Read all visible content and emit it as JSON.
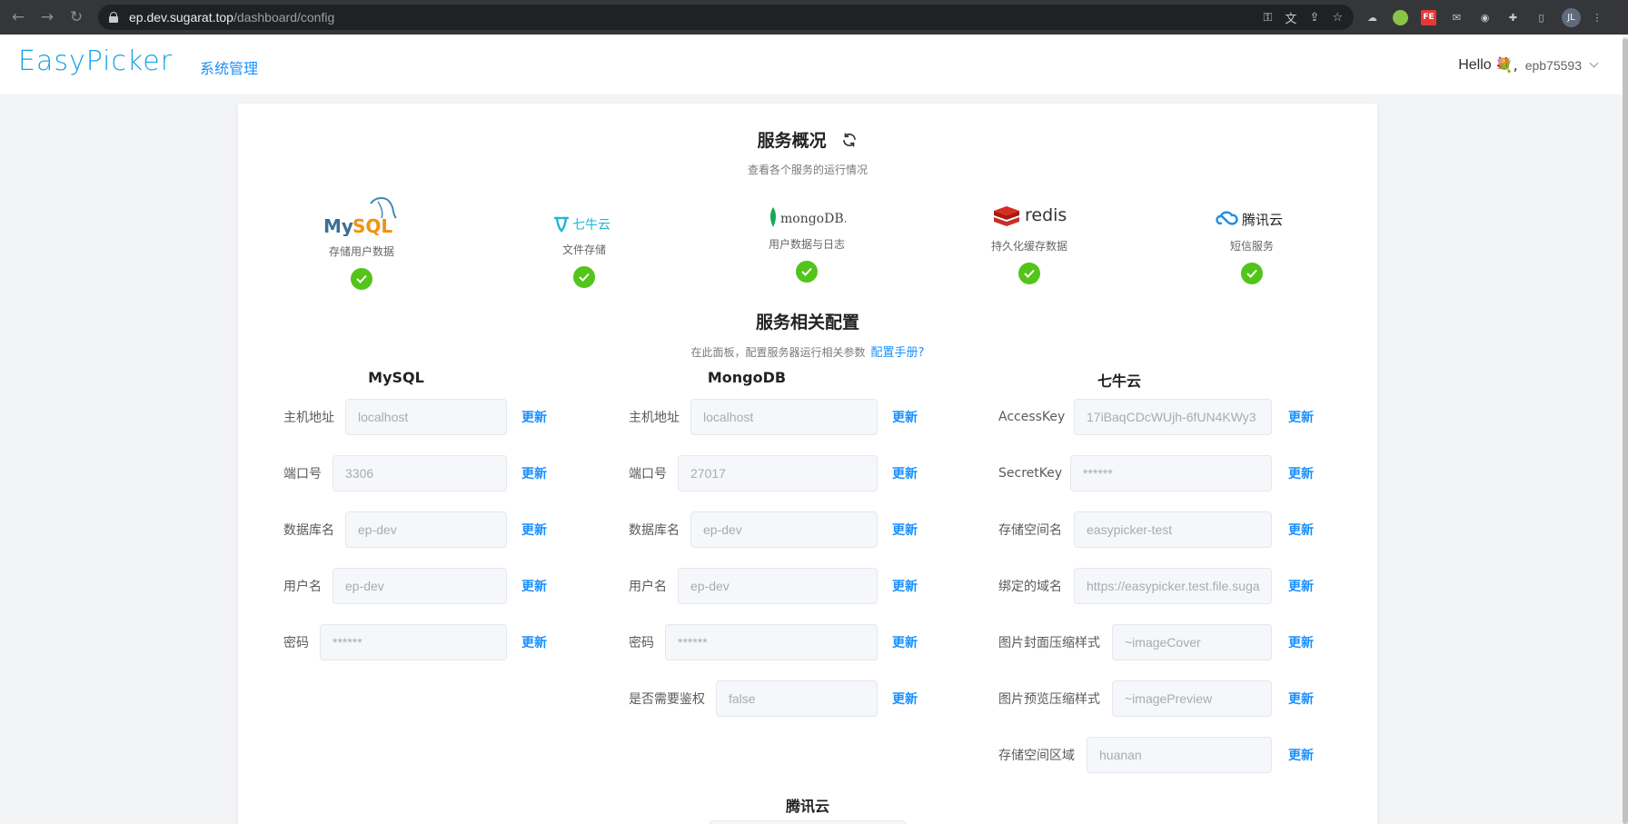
{
  "browser": {
    "url_host": "ep.dev.sugarat.top",
    "url_path": "/dashboard/config",
    "avatar": "JL"
  },
  "header": {
    "logo": "EasyPicker",
    "nav": "系统管理",
    "hello": "Hello",
    "flower": "💐,",
    "username": "epb75593"
  },
  "overview": {
    "title": "服务概况",
    "subtitle": "查看各个服务的运行情况",
    "services": [
      {
        "name": "MySQL",
        "desc": "存储用户数据",
        "status": "ok"
      },
      {
        "name": "七牛云",
        "desc": "文件存储",
        "status": "ok"
      },
      {
        "name": "mongoDB.",
        "desc": "用户数据与日志",
        "status": "ok"
      },
      {
        "name": "redis",
        "desc": "持久化缓存数据",
        "status": "ok"
      },
      {
        "name": "腾讯云",
        "desc": "短信服务",
        "status": "ok"
      }
    ]
  },
  "config": {
    "title": "服务相关配置",
    "subtitle": "在此面板，配置服务器运行相关参数",
    "manual": "配置手册?",
    "update_label": "更新",
    "mysql": {
      "title": "MySQL",
      "fields": [
        {
          "label": "主机地址",
          "value": "localhost"
        },
        {
          "label": "端口号",
          "value": "3306"
        },
        {
          "label": "数据库名",
          "value": "ep-dev"
        },
        {
          "label": "用户名",
          "value": "ep-dev"
        },
        {
          "label": "密码",
          "value": "******"
        }
      ]
    },
    "mongodb": {
      "title": "MongoDB",
      "fields": [
        {
          "label": "主机地址",
          "value": "localhost"
        },
        {
          "label": "端口号",
          "value": "27017"
        },
        {
          "label": "数据库名",
          "value": "ep-dev"
        },
        {
          "label": "用户名",
          "value": "ep-dev"
        },
        {
          "label": "密码",
          "value": "******"
        },
        {
          "label": "是否需要鉴权",
          "value": "false"
        }
      ]
    },
    "qiniu": {
      "title": "七牛云",
      "fields": [
        {
          "label": "AccessKey",
          "value": "17iBaqCDcWUjh-6fUN4KWy3"
        },
        {
          "label": "SecretKey",
          "value": "******"
        },
        {
          "label": "存储空间名",
          "value": "easypicker-test"
        },
        {
          "label": "绑定的域名",
          "value": "https://easypicker.test.file.suga"
        },
        {
          "label": "图片封面压缩样式",
          "value": "~imageCover"
        },
        {
          "label": "图片预览压缩样式",
          "value": "~imagePreview"
        },
        {
          "label": "存储空间区域",
          "value": "huanan"
        }
      ]
    },
    "tencent": {
      "title": "腾讯云"
    }
  },
  "colors": {
    "accent": "#1890ff",
    "success": "#52c41a",
    "logo": "#17a0e6"
  }
}
